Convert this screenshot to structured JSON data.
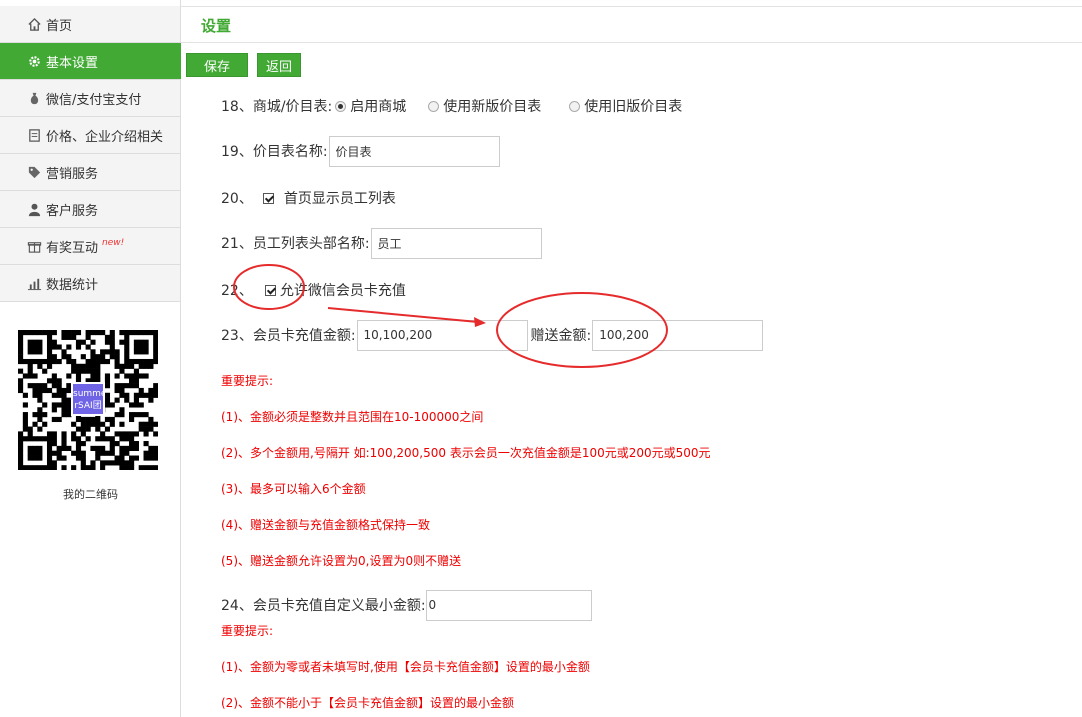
{
  "sidebar": {
    "items": [
      {
        "label": "首页",
        "icon": "home-icon"
      },
      {
        "label": "基本设置",
        "icon": "gear-icon"
      },
      {
        "label": "微信/支付宝支付",
        "icon": "money-bag-icon"
      },
      {
        "label": "价格、企业介绍相关",
        "icon": "document-icon"
      },
      {
        "label": "营销服务",
        "icon": "tag-icon"
      },
      {
        "label": "客户服务",
        "icon": "user-icon"
      },
      {
        "label": "有奖互动",
        "icon": "gift-icon",
        "badge": "new!"
      },
      {
        "label": "数据统计",
        "icon": "bar-chart-icon"
      }
    ],
    "qr_center_text": "summe rSAI团",
    "qr_caption": "我的二维码"
  },
  "header": {
    "title": "设置"
  },
  "toolbar": {
    "save_label": "保存",
    "back_label": "返回"
  },
  "form": {
    "r18": {
      "label": "18、商城/价目表:",
      "options": [
        "启用商城",
        "使用新版价目表",
        "使用旧版价目表"
      ],
      "selected": "启用商城"
    },
    "r19": {
      "label": "19、价目表名称:",
      "value": "价目表"
    },
    "r20": {
      "num": "20、",
      "label": "首页显示员工列表",
      "checked": true
    },
    "r21": {
      "label": "21、员工列表头部名称:",
      "value": "员工"
    },
    "r22": {
      "num": "22、",
      "label": "允许微信会员卡充值",
      "checked": true
    },
    "r23": {
      "label": "23、会员卡充值金额:",
      "value": "10,100,200",
      "bonus_label": "赠送金额:",
      "bonus_value": "100,200"
    },
    "tips1": {
      "title": "重要提示:",
      "lines": [
        "(1)、金额必须是整数并且范围在10-100000之间",
        "(2)、多个金额用,号隔开 如:100,200,500 表示会员一次充值金额是100元或200元或500元",
        "(3)、最多可以输入6个金额",
        "(4)、赠送金额与充值金额格式保持一致",
        "(5)、赠送金额允许设置为0,设置为0则不赠送"
      ]
    },
    "r24": {
      "label": "24、会员卡充值自定义最小金额:",
      "value": "0"
    },
    "tips2": {
      "title": "重要提示:",
      "lines": [
        "(1)、金额为零或者未填写时,使用【会员卡充值金额】设置的最小金额",
        "(2)、金额不能小于【会员卡充值金额】设置的最小金额"
      ]
    }
  },
  "colors": {
    "accent": "#41a934",
    "annotation": "#e52b2b",
    "tip_text": "#ee0000"
  }
}
